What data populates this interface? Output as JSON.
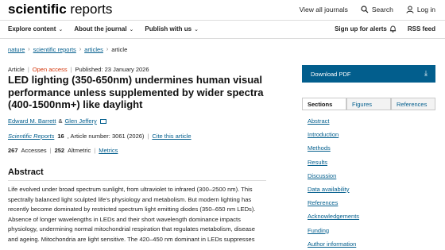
{
  "header": {
    "logo_bold": "scientific",
    "logo_rest": " reports",
    "view_journals": "View all journals",
    "search": "Search",
    "login": "Log in"
  },
  "navbar": {
    "explore": "Explore content",
    "about": "About the journal",
    "publish": "Publish with us",
    "signup": "Sign up for alerts",
    "rss": "RSS feed"
  },
  "breadcrumb": [
    "nature",
    "scientific reports",
    "articles",
    "article"
  ],
  "article": {
    "type": "Article",
    "access": "Open access",
    "published": "Published: 23 January 2026",
    "title": "LED lighting (350-650nm) undermines human visual performance unless supplemented by wider spectra (400-1500nm+) like daylight",
    "authors": [
      "Edward M. Barrett",
      "Glen Jeffery"
    ],
    "author_sep": "&",
    "journal": "Scientific Reports",
    "volume": "16",
    "article_number": ", Article number: 3061 (2026)",
    "cite": "Cite this article",
    "accesses_count": "267",
    "accesses_label": "Accesses",
    "altmetric_count": "252",
    "altmetric_label": "Altmetric",
    "metrics": "Metrics"
  },
  "abstract": {
    "heading": "Abstract",
    "text": "Life evolved under broad spectrum sunlight, from ultraviolet to infrared (300–2500 nm). This spectrally balanced light sculpted life's physiology and metabolism. But modern lighting has recently become dominated by restricted spectrum light emitting diodes (350–650 nm LEDs). Absence of longer wavelengths in LEDs and their short wavelength dominance impacts physiology, undermining normal mitochondrial respiration that regulates metabolism, disease and ageing. Mitochondria are light sensitive. The 420–450 nm dominant in LEDs suppresses"
  },
  "sidebar": {
    "download": "Download PDF",
    "tabs": [
      "Sections",
      "Figures",
      "References"
    ],
    "sections": [
      "Abstract",
      "Introduction",
      "Methods",
      "Results",
      "Discussion",
      "Data availability",
      "References",
      "Acknowledgements",
      "Funding",
      "Author information"
    ]
  },
  "colors": {
    "link": "#025e8d",
    "open_access": "#d4380d",
    "download_bg": "#025e8d"
  },
  "icons": [
    "search-icon",
    "user-icon",
    "chevron-down-icon",
    "bell-icon",
    "envelope-icon",
    "download-icon"
  ]
}
